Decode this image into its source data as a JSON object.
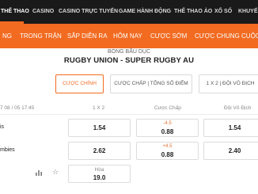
{
  "top_nav": {
    "items": [
      "THỂ THAO",
      "CASINO",
      "CASINO TRỰC TUYẾN",
      "GAME HÀNH ĐỘNG",
      "THỂ THAO ẢO",
      "XỔ SỐ",
      "KHUYẾ"
    ]
  },
  "sub_nav": {
    "items": [
      "NG",
      "TRONG TRẬN",
      "SẮP DIỄN RA",
      "HÔM NAY",
      "CƯỢC SỚM",
      "CƯỢC CHUNG CUỘC"
    ]
  },
  "event": {
    "sport": "BÓNG BẦU DỤC",
    "league": "RUGBY UNION - SUPER RUGBY AU"
  },
  "market_tabs": [
    "CƯỢC CHÍNH",
    "CƯỢC CHẤP | TỔNG SỐ ĐIỂM",
    "1 X 2 | ĐỘI VÔ ĐỊCH"
  ],
  "table": {
    "date": "7 08 / 05 17:45",
    "headers": [
      "1 X 2",
      "Cược Chấp",
      "Đội Vô Địch"
    ],
    "rows": [
      {
        "team": "is",
        "odds_1x2": "1.54",
        "handicap": "-4.5",
        "handicap_odds": "0.88",
        "outright": "1.54"
      },
      {
        "team": "mbies",
        "odds_1x2": "2.62",
        "handicap": "+4.5",
        "handicap_odds": "0.88",
        "outright": "2.40"
      }
    ],
    "draw": {
      "label": "Hòa",
      "odds": "19.0"
    }
  },
  "icons": [
    "stats-icon",
    "favorite-star-icon"
  ],
  "colors": {
    "accent": "#f26b21",
    "nav_bg": "#1a1a1a"
  }
}
